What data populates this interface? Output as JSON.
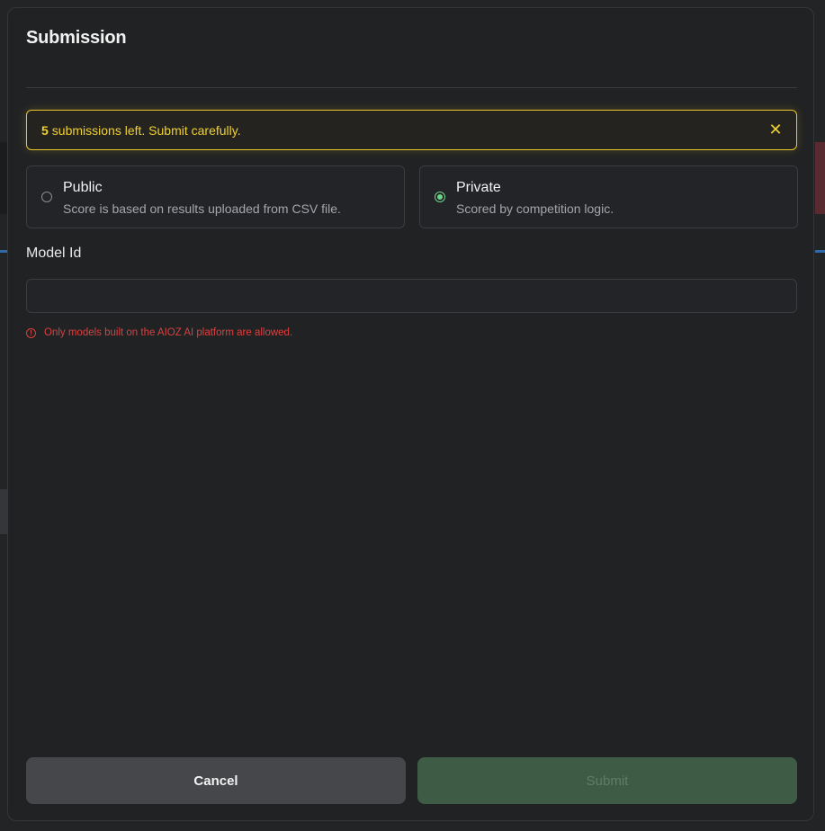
{
  "modal": {
    "title": "Submission",
    "alert": {
      "count": "5",
      "message": "submissions left. Submit carefully.",
      "close_glyph": "✕"
    },
    "options": [
      {
        "title": "Public",
        "description": "Score is based on results uploaded from CSV file.",
        "selected": false
      },
      {
        "title": "Private",
        "description": "Scored by competition logic.",
        "selected": true
      }
    ],
    "model_id": {
      "label": "Model Id",
      "value": "",
      "placeholder": ""
    },
    "error": {
      "icon_glyph": "!",
      "text": "Only models built on the AIOZ AI platform are allowed."
    },
    "buttons": {
      "cancel": "Cancel",
      "submit": "Submit"
    }
  },
  "colors": {
    "accent_yellow": "#f0d12e",
    "radio_green": "#6fd38a",
    "error_red": "#d9403f",
    "submit_bg": "#3e5b46"
  }
}
